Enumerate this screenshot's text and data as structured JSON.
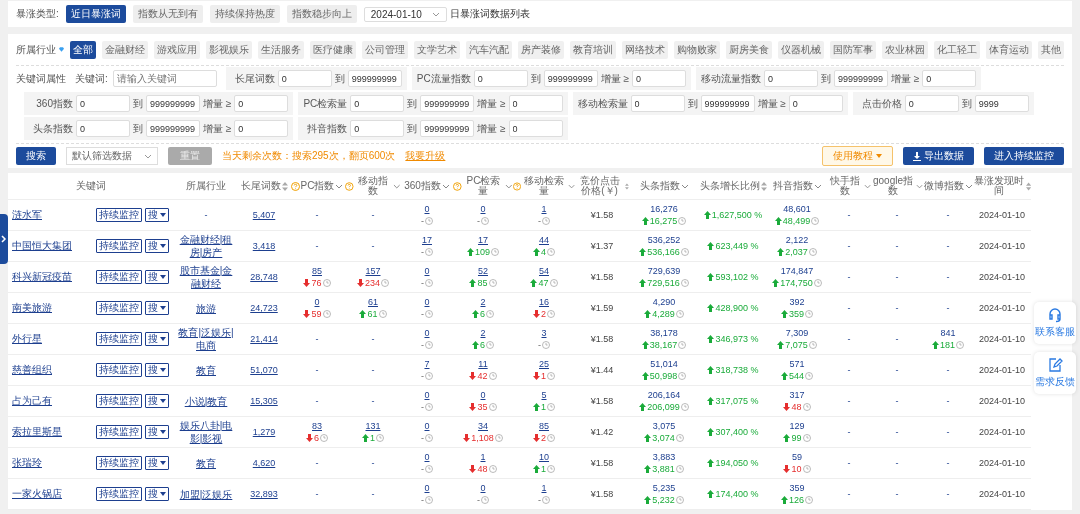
{
  "top": {
    "label": "暴涨类型:",
    "tabs": [
      {
        "label": "近日暴涨词",
        "selected": true
      },
      {
        "label": "指数从无到有",
        "selected": false
      },
      {
        "label": "持续保持热度",
        "selected": false
      },
      {
        "label": "指数稳步向上",
        "selected": false
      }
    ],
    "date": "2024-01-10",
    "caption": "日暴涨词数据列表"
  },
  "industry": {
    "label": "所属行业",
    "tags": [
      {
        "label": "全部",
        "selected": true
      },
      {
        "label": "金融财经",
        "selected": false
      },
      {
        "label": "游戏应用",
        "selected": false
      },
      {
        "label": "影视娱乐",
        "selected": false
      },
      {
        "label": "生活服务",
        "selected": false
      },
      {
        "label": "医疗健康",
        "selected": false
      },
      {
        "label": "公司管理",
        "selected": false
      },
      {
        "label": "文学艺术",
        "selected": false
      },
      {
        "label": "汽车汽配",
        "selected": false
      },
      {
        "label": "房产装修",
        "selected": false
      },
      {
        "label": "教育培训",
        "selected": false
      },
      {
        "label": "网络技术",
        "selected": false
      },
      {
        "label": "购物败家",
        "selected": false
      },
      {
        "label": "厨房美食",
        "selected": false
      },
      {
        "label": "仪器机械",
        "selected": false
      },
      {
        "label": "国防军事",
        "selected": false
      },
      {
        "label": "农业林园",
        "selected": false
      },
      {
        "label": "化工轻工",
        "selected": false
      },
      {
        "label": "体育运动",
        "selected": false
      },
      {
        "label": "其他",
        "selected": false
      }
    ]
  },
  "filters": {
    "label": "关键词属性",
    "keyword": {
      "label": "关键词:",
      "placeholder": "请输入关键词"
    },
    "rows": [
      {
        "groups": [
          {
            "label": "长尾词数",
            "from": "0",
            "to_label": "到",
            "to": "999999999"
          },
          {
            "label": "PC流量指数",
            "from": "0",
            "to_label": "到",
            "to": "999999999",
            "delta_label": "增量 ≥",
            "delta": "0"
          },
          {
            "label": "移动流量指数",
            "from": "0",
            "to_label": "到",
            "to": "999999999",
            "delta_label": "增量 ≥",
            "delta": "0"
          }
        ]
      },
      {
        "groups": [
          {
            "label": "360指数",
            "from": "0",
            "to_label": "到",
            "to": "999999999",
            "delta_label": "增量 ≥",
            "delta": "0"
          },
          {
            "label": "PC检索量",
            "from": "0",
            "to_label": "到",
            "to": "999999999",
            "delta_label": "增量 ≥",
            "delta": "0"
          },
          {
            "label": "移动检索量",
            "from": "0",
            "to_label": "到",
            "to": "999999999",
            "delta_label": "增量 ≥",
            "delta": "0"
          },
          {
            "label": "点击价格",
            "from": "0",
            "to_label": "到",
            "to": "9999"
          }
        ]
      },
      {
        "groups": [
          {
            "label": "头条指数",
            "from": "0",
            "to_label": "到",
            "to": "999999999",
            "delta_label": "增量 ≥",
            "delta": "0"
          },
          {
            "label": "抖音指数",
            "from": "0",
            "to_label": "到",
            "to": "999999999",
            "delta_label": "增量 ≥",
            "delta": "0"
          }
        ]
      }
    ]
  },
  "actions": {
    "search": "搜索",
    "preset": "默认筛选数据",
    "reset": {
      "label": "重置",
      "disabled": true
    },
    "notice": "当天剩余次数：搜索295次，翻页600次",
    "upgrade": "我要升级",
    "tutorial": "使用教程",
    "export": "导出数据",
    "monitor": "进入持续监控"
  },
  "table": {
    "columns": [
      {
        "label": "关键词",
        "kind": "keyword",
        "help": false,
        "sortable": false,
        "filterable": false
      },
      {
        "label": "所属行业",
        "kind": "industry",
        "help": false,
        "sortable": false,
        "filterable": false
      },
      {
        "label": "长尾词数",
        "kind": "link",
        "help": false,
        "sortable": true,
        "filterable": false
      },
      {
        "label": "PC指数",
        "kind": "link-metric",
        "help": true,
        "sortable": false,
        "filterable": true
      },
      {
        "label": "移动指数",
        "kind": "link-metric",
        "help": true,
        "sortable": false,
        "filterable": true
      },
      {
        "label": "360指数",
        "kind": "link-metric",
        "help": false,
        "sortable": false,
        "filterable": true
      },
      {
        "label": "PC检索量",
        "kind": "link-metric",
        "help": true,
        "sortable": false,
        "filterable": true
      },
      {
        "label": "移动检索量",
        "kind": "link-metric",
        "help": true,
        "sortable": false,
        "filterable": true
      },
      {
        "label": "竞价点击价格(￥)",
        "kind": "text",
        "help": false,
        "sortable": true,
        "filterable": false
      },
      {
        "label": "头条指数",
        "kind": "metric",
        "help": false,
        "sortable": false,
        "filterable": true
      },
      {
        "label": "头条增长比例",
        "kind": "growth",
        "help": false,
        "sortable": true,
        "filterable": false
      },
      {
        "label": "抖音指数",
        "kind": "metric",
        "help": false,
        "sortable": false,
        "filterable": true
      },
      {
        "label": "快手指数",
        "kind": "metric",
        "help": false,
        "sortable": false,
        "filterable": true
      },
      {
        "label": "google指数",
        "kind": "metric",
        "help": false,
        "sortable": false,
        "filterable": true
      },
      {
        "label": "微博指数",
        "kind": "metric",
        "help": false,
        "sortable": false,
        "filterable": true
      },
      {
        "label": "暴涨发现时间",
        "kind": "text",
        "help": false,
        "sortable": true,
        "filterable": false
      }
    ],
    "rows": [
      {
        "cells": [
          {
            "keyword": "涟水军",
            "monitor": "持续监控",
            "search": "搜"
          },
          {
            "value": "-",
            "link": false
          },
          {
            "value": "5,407"
          },
          {
            "value": "-"
          },
          {
            "value": "-"
          },
          {
            "value": "0",
            "delta": "-",
            "up": false,
            "down": false
          },
          {
            "value": "0",
            "delta": "-",
            "up": false,
            "down": false
          },
          {
            "value": "1",
            "delta": "-",
            "up": false,
            "down": false
          },
          {
            "value": "¥1.58"
          },
          {
            "value": "16,276",
            "delta": "16,275",
            "up": true,
            "down": false
          },
          {
            "value": "1,627,500 %",
            "up": true,
            "down": false
          },
          {
            "value": "48,601",
            "delta": "48,499",
            "up": true,
            "down": false
          },
          {
            "value": "-"
          },
          {
            "value": "-"
          },
          {
            "value": "-"
          },
          {
            "value": "2024-01-10"
          }
        ]
      },
      {
        "cells": [
          {
            "keyword": "中国恒大集团",
            "monitor": "持续监控",
            "search": "搜"
          },
          {
            "value": "金融财经|租房|房产",
            "link": true
          },
          {
            "value": "3,418"
          },
          {
            "value": "-"
          },
          {
            "value": "-"
          },
          {
            "value": "17",
            "delta": "-",
            "up": false,
            "down": false
          },
          {
            "value": "17",
            "delta": "109",
            "up": true,
            "down": false
          },
          {
            "value": "44",
            "delta": "4",
            "up": true,
            "down": false
          },
          {
            "value": "¥1.37"
          },
          {
            "value": "536,252",
            "delta": "536,166",
            "up": true,
            "down": false
          },
          {
            "value": "623,449 %",
            "up": true,
            "down": false
          },
          {
            "value": "2,122",
            "delta": "2,037",
            "up": true,
            "down": false
          },
          {
            "value": "-"
          },
          {
            "value": "-"
          },
          {
            "value": "-"
          },
          {
            "value": "2024-01-10"
          }
        ]
      },
      {
        "cells": [
          {
            "keyword": "科兴新冠疫苗",
            "monitor": "持续监控",
            "search": "搜"
          },
          {
            "value": "股市基金|金融财经",
            "link": true
          },
          {
            "value": "28,748"
          },
          {
            "value": "85",
            "delta": "76",
            "up": false,
            "down": true
          },
          {
            "value": "157",
            "delta": "234",
            "up": false,
            "down": true
          },
          {
            "value": "0",
            "delta": "-",
            "up": false,
            "down": false
          },
          {
            "value": "52",
            "delta": "85",
            "up": true,
            "down": false
          },
          {
            "value": "54",
            "delta": "47",
            "up": true,
            "down": false
          },
          {
            "value": "¥1.58"
          },
          {
            "value": "729,639",
            "delta": "729,516",
            "up": true,
            "down": false
          },
          {
            "value": "593,102 %",
            "up": true,
            "down": false
          },
          {
            "value": "174,847",
            "delta": "174,750",
            "up": true,
            "down": false
          },
          {
            "value": "-"
          },
          {
            "value": "-"
          },
          {
            "value": "-"
          },
          {
            "value": "2024-01-10"
          }
        ]
      },
      {
        "cells": [
          {
            "keyword": "南美旅游",
            "monitor": "持续监控",
            "search": "搜"
          },
          {
            "value": "旅游",
            "link": true
          },
          {
            "value": "24,723"
          },
          {
            "value": "0",
            "delta": "59",
            "up": false,
            "down": true
          },
          {
            "value": "61",
            "delta": "61",
            "up": true,
            "down": false
          },
          {
            "value": "0",
            "delta": "-",
            "up": false,
            "down": false
          },
          {
            "value": "2",
            "delta": "6",
            "up": true,
            "down": false
          },
          {
            "value": "16",
            "delta": "2",
            "up": false,
            "down": true
          },
          {
            "value": "¥1.59"
          },
          {
            "value": "4,290",
            "delta": "4,289",
            "up": true,
            "down": false
          },
          {
            "value": "428,900 %",
            "up": true,
            "down": false
          },
          {
            "value": "392",
            "delta": "359",
            "up": true,
            "down": false
          },
          {
            "value": "-"
          },
          {
            "value": "-"
          },
          {
            "value": "-"
          },
          {
            "value": "2024-01-10"
          }
        ]
      },
      {
        "cells": [
          {
            "keyword": "外行星",
            "monitor": "持续监控",
            "search": "搜"
          },
          {
            "value": "教育|泛娱乐|电商",
            "link": true
          },
          {
            "value": "21,414"
          },
          {
            "value": "-"
          },
          {
            "value": "-"
          },
          {
            "value": "0",
            "delta": "-",
            "up": false,
            "down": false
          },
          {
            "value": "2",
            "delta": "6",
            "up": true,
            "down": false
          },
          {
            "value": "3",
            "delta": "-",
            "up": false,
            "down": false
          },
          {
            "value": "¥1.58"
          },
          {
            "value": "38,178",
            "delta": "38,167",
            "up": true,
            "down": false
          },
          {
            "value": "346,973 %",
            "up": true,
            "down": false
          },
          {
            "value": "7,309",
            "delta": "7,075",
            "up": true,
            "down": false
          },
          {
            "value": "-"
          },
          {
            "value": "-"
          },
          {
            "value": "841",
            "delta": "181",
            "up": true,
            "down": false
          },
          {
            "value": "2024-01-10"
          }
        ]
      },
      {
        "cells": [
          {
            "keyword": "慈善组织",
            "monitor": "持续监控",
            "search": "搜"
          },
          {
            "value": "教育",
            "link": true
          },
          {
            "value": "51,070"
          },
          {
            "value": "-"
          },
          {
            "value": "-"
          },
          {
            "value": "7",
            "delta": "-",
            "up": false,
            "down": false
          },
          {
            "value": "11",
            "delta": "42",
            "up": false,
            "down": true
          },
          {
            "value": "25",
            "delta": "1",
            "up": false,
            "down": true
          },
          {
            "value": "¥1.44"
          },
          {
            "value": "51,014",
            "delta": "50,998",
            "up": true,
            "down": false
          },
          {
            "value": "318,738 %",
            "up": true,
            "down": false
          },
          {
            "value": "571",
            "delta": "544",
            "up": true,
            "down": false
          },
          {
            "value": "-"
          },
          {
            "value": "-"
          },
          {
            "value": "-"
          },
          {
            "value": "2024-01-10"
          }
        ]
      },
      {
        "cells": [
          {
            "keyword": "占为己有",
            "monitor": "持续监控",
            "search": "搜"
          },
          {
            "value": "小说|教育",
            "link": true
          },
          {
            "value": "15,305"
          },
          {
            "value": "-"
          },
          {
            "value": "-"
          },
          {
            "value": "0",
            "delta": "-",
            "up": false,
            "down": false
          },
          {
            "value": "0",
            "delta": "35",
            "up": false,
            "down": true
          },
          {
            "value": "5",
            "delta": "1",
            "up": true,
            "down": false
          },
          {
            "value": "¥1.58"
          },
          {
            "value": "206,164",
            "delta": "206,099",
            "up": true,
            "down": false
          },
          {
            "value": "317,075 %",
            "up": true,
            "down": false
          },
          {
            "value": "317",
            "delta": "48",
            "up": false,
            "down": true
          },
          {
            "value": "-"
          },
          {
            "value": "-"
          },
          {
            "value": "-"
          },
          {
            "value": "2024-01-10"
          }
        ]
      },
      {
        "cells": [
          {
            "keyword": "索拉里斯星",
            "monitor": "持续监控",
            "search": "搜"
          },
          {
            "value": "娱乐八卦|电影|影视",
            "link": true
          },
          {
            "value": "1,279"
          },
          {
            "value": "83",
            "delta": "6",
            "up": false,
            "down": true
          },
          {
            "value": "131",
            "delta": "1",
            "up": true,
            "down": false
          },
          {
            "value": "0",
            "delta": "-",
            "up": false,
            "down": false
          },
          {
            "value": "34",
            "delta": "1,108",
            "up": false,
            "down": true
          },
          {
            "value": "85",
            "delta": "2",
            "up": false,
            "down": true
          },
          {
            "value": "¥1.42"
          },
          {
            "value": "3,075",
            "delta": "3,074",
            "up": true,
            "down": false
          },
          {
            "value": "307,400 %",
            "up": true,
            "down": false
          },
          {
            "value": "129",
            "delta": "99",
            "up": true,
            "down": false
          },
          {
            "value": "-"
          },
          {
            "value": "-"
          },
          {
            "value": "-"
          },
          {
            "value": "2024-01-10"
          }
        ]
      },
      {
        "cells": [
          {
            "keyword": "张瑞玲",
            "monitor": "持续监控",
            "search": "搜"
          },
          {
            "value": "教育",
            "link": true
          },
          {
            "value": "4,620"
          },
          {
            "value": "-"
          },
          {
            "value": "-"
          },
          {
            "value": "0",
            "delta": "-",
            "up": false,
            "down": false
          },
          {
            "value": "1",
            "delta": "48",
            "up": false,
            "down": true
          },
          {
            "value": "10",
            "delta": "1",
            "up": true,
            "down": false
          },
          {
            "value": "¥1.58"
          },
          {
            "value": "3,883",
            "delta": "3,881",
            "up": true,
            "down": false
          },
          {
            "value": "194,050 %",
            "up": true,
            "down": false
          },
          {
            "value": "59",
            "delta": "10",
            "up": false,
            "down": true
          },
          {
            "value": "-"
          },
          {
            "value": "-"
          },
          {
            "value": "-"
          },
          {
            "value": "2024-01-10"
          }
        ]
      },
      {
        "cells": [
          {
            "keyword": "一家火锅店",
            "monitor": "持续监控",
            "search": "搜"
          },
          {
            "value": "加盟|泛娱乐",
            "link": true
          },
          {
            "value": "32,893"
          },
          {
            "value": "-"
          },
          {
            "value": "-"
          },
          {
            "value": "0",
            "delta": "-",
            "up": false,
            "down": false
          },
          {
            "value": "0",
            "delta": "-",
            "up": false,
            "down": false
          },
          {
            "value": "1",
            "delta": "-",
            "up": false,
            "down": false
          },
          {
            "value": "¥1.58"
          },
          {
            "value": "5,235",
            "delta": "5,232",
            "up": true,
            "down": false
          },
          {
            "value": "174,400 %",
            "up": true,
            "down": false
          },
          {
            "value": "359",
            "delta": "126",
            "up": true,
            "down": false
          },
          {
            "value": "-"
          },
          {
            "value": "-"
          },
          {
            "value": "-"
          },
          {
            "value": "2024-01-10"
          }
        ]
      }
    ]
  },
  "floating": [
    {
      "label": "联系客服",
      "kind": "headset"
    },
    {
      "label": "需求反馈",
      "kind": "edit"
    }
  ]
}
